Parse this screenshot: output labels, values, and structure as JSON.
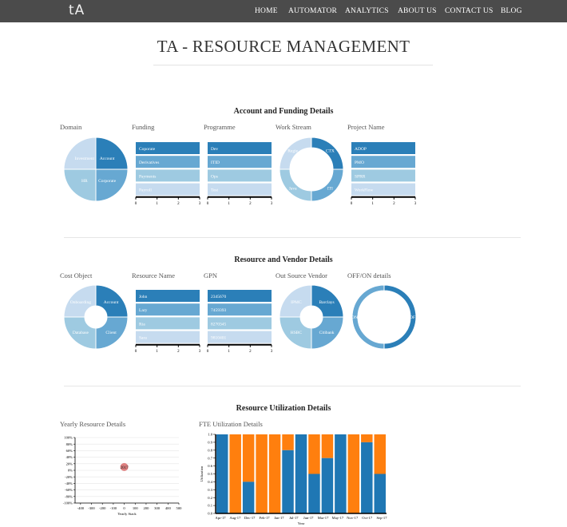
{
  "logo": "tA",
  "nav": [
    "HOME",
    "AUTOMATOR",
    "ANALYTICS",
    "ABOUT US",
    "CONTACT US",
    "BLOG"
  ],
  "page_title": "TA - RESOURCE MANAGEMENT",
  "sections": {
    "account": "Account and Funding Details",
    "resource": "Resource and Vendor Details",
    "utilization": "Resource Utilization Details"
  },
  "labels": {
    "domain": "Domain",
    "funding": "Funding",
    "programme": "Programme",
    "work_stream": "Work Stream",
    "project_name": "Project Name",
    "cost_object": "Cost Object",
    "resource_name": "Resource Name",
    "gpn": "GPN",
    "vendor": "Out Source Vendor",
    "offon": "OFF/ON details",
    "yearly": "Yearly Resource Details",
    "fte": "FTE Utilization Details"
  },
  "colors": {
    "c1": "#2b7fb8",
    "c2": "#67a8d2",
    "c3": "#9ecae1",
    "c4": "#c6dbef",
    "orange": "#fd8d3c"
  },
  "bar_axis_ticks": [
    "0",
    "1",
    "2",
    "3"
  ],
  "pies": {
    "domain": [
      {
        "label": "Account",
        "value": 1
      },
      {
        "label": "Corporate",
        "value": 1
      },
      {
        "label": "HR",
        "value": 1
      },
      {
        "label": "Investment",
        "value": 1
      }
    ],
    "work_stream": [
      {
        "label": "CTX",
        "value": 1
      },
      {
        "label": "ITI",
        "value": 1
      },
      {
        "label": "Java",
        "value": 1
      },
      {
        "label": "Regie",
        "value": 1
      }
    ],
    "cost_object": [
      {
        "label": "Account",
        "value": 1
      },
      {
        "label": "Client",
        "value": 1
      },
      {
        "label": "Database",
        "value": 1
      },
      {
        "label": "Onboarding",
        "value": 1
      }
    ],
    "vendor": [
      {
        "label": "Barclays",
        "value": 1
      },
      {
        "label": "Citibank",
        "value": 1
      },
      {
        "label": "HSBC",
        "value": 1
      },
      {
        "label": "IPMC",
        "value": 1
      }
    ],
    "offon": [
      {
        "label": "OFF",
        "value": 1
      },
      {
        "label": "ON",
        "value": 1
      }
    ]
  },
  "bars": {
    "funding": [
      {
        "label": "Coporate",
        "value": 3
      },
      {
        "label": "Derivatives",
        "value": 3
      },
      {
        "label": "Payments",
        "value": 3
      },
      {
        "label": "Payroll",
        "value": 3
      }
    ],
    "programme": [
      {
        "label": "Dev",
        "value": 3
      },
      {
        "label": "ITID",
        "value": 3
      },
      {
        "label": "Ops",
        "value": 3
      },
      {
        "label": "Test",
        "value": 3
      }
    ],
    "project_name": [
      {
        "label": "ADOP",
        "value": 3
      },
      {
        "label": "PMO",
        "value": 3
      },
      {
        "label": "SPRR",
        "value": 3
      },
      {
        "label": "WorkFlow",
        "value": 3
      }
    ],
    "resource_name": [
      {
        "label": "John",
        "value": 3
      },
      {
        "label": "Lary",
        "value": 3
      },
      {
        "label": "Ria",
        "value": 3
      },
      {
        "label": "Sara",
        "value": 3
      }
    ],
    "gpn": [
      {
        "label": "2345670",
        "value": 3
      },
      {
        "label": "7459393",
        "value": 3
      },
      {
        "label": "8270345",
        "value": 3
      },
      {
        "label": "9810401",
        "value": 3
      }
    ]
  },
  "chart_data": [
    {
      "type": "scatter",
      "title": "Yearly Resource Details",
      "xlabel": "Yearly Stack",
      "ylabel": "",
      "xlim": [
        -450,
        500
      ],
      "ylim": [
        -100,
        100
      ],
      "x_ticks": [
        "-400",
        "-300",
        "-200",
        "-100",
        "0",
        "100",
        "200",
        "300",
        "400",
        "500"
      ],
      "y_ticks": [
        "100%",
        "80%",
        "60%",
        "40%",
        "20%",
        "0%",
        "-20%",
        "-40%",
        "-60%",
        "-80%",
        "-100%"
      ],
      "points": [
        {
          "x": 0,
          "y": 10,
          "label": "2017"
        }
      ],
      "grid": true
    },
    {
      "type": "bar",
      "title": "FTE Utilization Details",
      "xlabel": "Year",
      "ylabel": "Utilization",
      "ylim": [
        0,
        1
      ],
      "y_ticks": [
        "0.0",
        "0.1",
        "0.2",
        "0.3",
        "0.4",
        "0.5",
        "0.6",
        "0.7",
        "0.8",
        "0.9",
        "1.0"
      ],
      "x_ticks": [
        "Apr-17",
        "Aug-17",
        "Dec-17",
        "Feb-17",
        "Jan-17",
        "Jul-17",
        "Jun-17",
        "Mar-17",
        "May-17",
        "Nov-17",
        "Oct-17",
        "Sep-17"
      ],
      "values": [
        1.0,
        0.0,
        0.4,
        0.0,
        0.0,
        0.8,
        1.0,
        0.5,
        0.7,
        1.0,
        0.0,
        0.9,
        0.5
      ],
      "colors": {
        "utilized": "#1f77b4",
        "remaining": "#ff7f0e"
      }
    }
  ]
}
